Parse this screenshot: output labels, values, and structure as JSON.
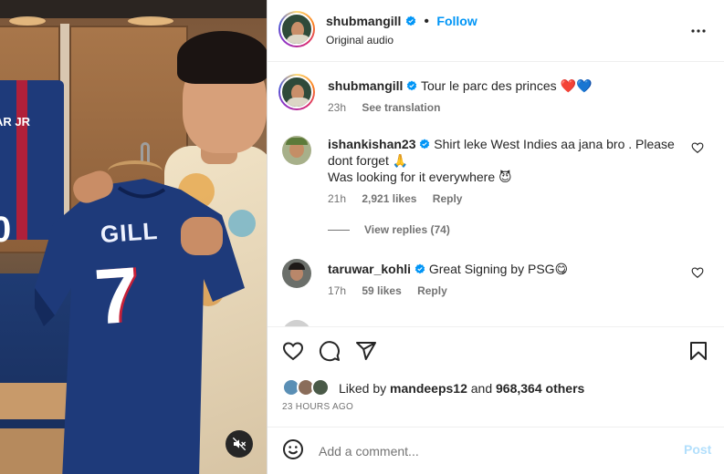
{
  "post": {
    "author": "shubmangill",
    "follow_label": "Follow",
    "audio": "Original audio"
  },
  "caption": {
    "author": "shubmangill",
    "text": "Tour le parc des princes",
    "emoji": "❤️💙",
    "time": "23h",
    "translate": "See translation"
  },
  "comments": [
    {
      "author": "ishankishan23",
      "text_line1": "Shirt leke West Indies aa jana bro . Please",
      "text_line2": "dont forget 🙏",
      "text_line3": "Was looking for it everywhere 😈",
      "time": "21h",
      "likes": "2,921 likes",
      "reply": "Reply",
      "view_replies": "View replies (74)"
    },
    {
      "author": "taruwar_kohli",
      "text": "Great Signing by PSG😋",
      "time": "17h",
      "likes": "59 likes",
      "reply": "Reply"
    }
  ],
  "likes": {
    "prefix": "Liked by",
    "user": "mandeeps12",
    "and": "and",
    "others": "968,364 others"
  },
  "timestamp": "23 HOURS AGO",
  "composer": {
    "placeholder": "Add a comment...",
    "post_label": "Post"
  },
  "media": {
    "jersey_name": "GILL",
    "jersey_number": "7",
    "left_jersey_text": "AR JR",
    "left_jersey_number": "0"
  },
  "colors": {
    "accent": "#0095f6",
    "verified": "#0095f6",
    "heart": "#ed4956",
    "psg_blue": "#1e3a7a",
    "psg_red": "#c62038"
  },
  "icons": [
    "heart-icon",
    "comment-icon",
    "share-icon",
    "bookmark-icon",
    "more-icon",
    "emoji-icon",
    "mute-icon",
    "verified-icon"
  ]
}
